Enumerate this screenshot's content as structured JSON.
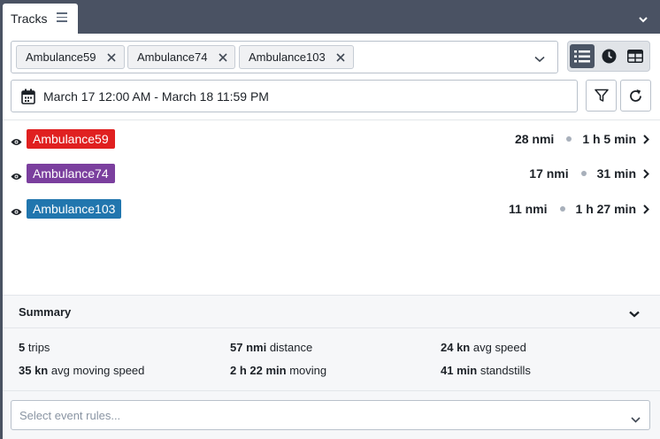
{
  "tab": {
    "title": "Tracks"
  },
  "filters": {
    "selected_tracks": [
      "Ambulance59",
      "Ambulance74",
      "Ambulance103"
    ],
    "date_range": "March 17 12:00 AM - March 18 11:59 PM"
  },
  "view_modes": [
    "list-view",
    "timeline-view",
    "table-view"
  ],
  "tracks": [
    {
      "name": "Ambulance59",
      "color": "#e02020",
      "distance": "28 nmi",
      "duration": "1 h 5 min"
    },
    {
      "name": "Ambulance74",
      "color": "#7b3f9e",
      "distance": "17 nmi",
      "duration": "31 min"
    },
    {
      "name": "Ambulance103",
      "color": "#2176ae",
      "distance": "11 nmi",
      "duration": "1 h 27 min"
    }
  ],
  "summary": {
    "title": "Summary",
    "trips_value": "5",
    "trips_label": "trips",
    "distance_value": "57 nmi",
    "distance_label": "distance",
    "avg_speed_value": "24 kn",
    "avg_speed_label": "avg speed",
    "avg_moving_value": "35 kn",
    "avg_moving_label": "avg moving speed",
    "moving_value": "2 h 22 min",
    "moving_label": "moving",
    "standstills_value": "41 min",
    "standstills_label": "standstills"
  },
  "event_rules": {
    "placeholder": "Select event rules..."
  }
}
